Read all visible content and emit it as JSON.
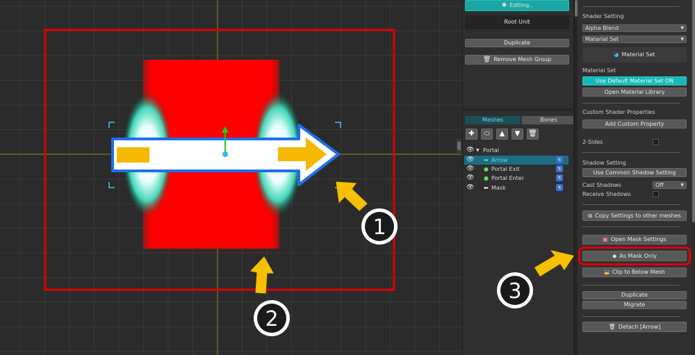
{
  "viewport": {
    "callouts": [
      "1",
      "2",
      "3"
    ],
    "colors": {
      "grid_bg": "#2b2b2b",
      "axis": "#8a8a2a",
      "red_highlight": "#e00000",
      "mesh_fill": "#ff0000",
      "arrow_fill": "#f6b800",
      "arrow_outline": "#1f6fe6",
      "portal_glow": "#41e0c0"
    }
  },
  "mid_panel": {
    "editing_button": {
      "icon": "mesh-icon",
      "label": "Editing.."
    },
    "root_unit_label": "Root Unit",
    "duplicate_label": "Duplicate",
    "remove_mesh_group": {
      "icon": "trash-icon",
      "label": "Remove Mesh Group"
    },
    "tabs": [
      "Meshes",
      "Bones"
    ],
    "tools": [
      "add-icon",
      "add-mesh-icon",
      "move-up-icon",
      "move-down-icon",
      "trash-icon"
    ],
    "tree": [
      {
        "label": "Portal",
        "icon": "collapse-arrow-icon",
        "selected": false,
        "linked": false
      },
      {
        "label": "Arrow",
        "icon": "mesh-arrow-icon",
        "selected": true,
        "linked": true
      },
      {
        "label": "Portal Exit",
        "icon": "mesh-dot-icon",
        "selected": false,
        "linked": true
      },
      {
        "label": "Portal Enter",
        "icon": "mesh-dot-icon",
        "selected": false,
        "linked": true
      },
      {
        "label": "Mask",
        "icon": "mask-icon",
        "selected": false,
        "linked": true
      }
    ],
    "colors": {
      "editing_bg": "#1aa6a2",
      "selected_row": "#1e6d84",
      "linked_icon": "#3b6fd0"
    }
  },
  "inspector": {
    "shader_setting_label": "Shader Setting",
    "blend_select": "Alpha Blend",
    "material_select": "Material Set",
    "material_set_button": {
      "icon": "material-sphere-icon",
      "label": "Material Set"
    },
    "material_set_label": "Material Set",
    "use_default_button": "Use Default Material Set ON",
    "open_library_button": "Open Material Library",
    "custom_shader_label": "Custom Shader Properties",
    "add_property_button": "Add Custom Property",
    "two_sides_label": "2-Sides",
    "shadow_setting_label": "Shadow Setting",
    "use_common_shadow_button": "Use Common Shadow Setting",
    "cast_shadows_label": "Cast Shadows",
    "cast_shadows_value": "Off",
    "receive_shadows_label": "Receive Shadows",
    "copy_settings_button": {
      "icon": "copy-icon",
      "label": "Copy Settings to other meshes"
    },
    "open_mask_button": {
      "icon": "mask-settings-icon",
      "label": "Open Mask Settings"
    },
    "as_mask_only_button": {
      "icon": "diamond-icon",
      "label": "As Mask Only"
    },
    "clip_below_button": {
      "icon": "clip-icon",
      "label": "Clip to Below Mesh"
    },
    "duplicate_button": "Duplicate",
    "migrate_button": "Migrate",
    "detach_button": {
      "icon": "trash-icon",
      "label": "Detach [Arrow]"
    },
    "colors": {
      "use_default_bg": "#18b8b8"
    }
  }
}
